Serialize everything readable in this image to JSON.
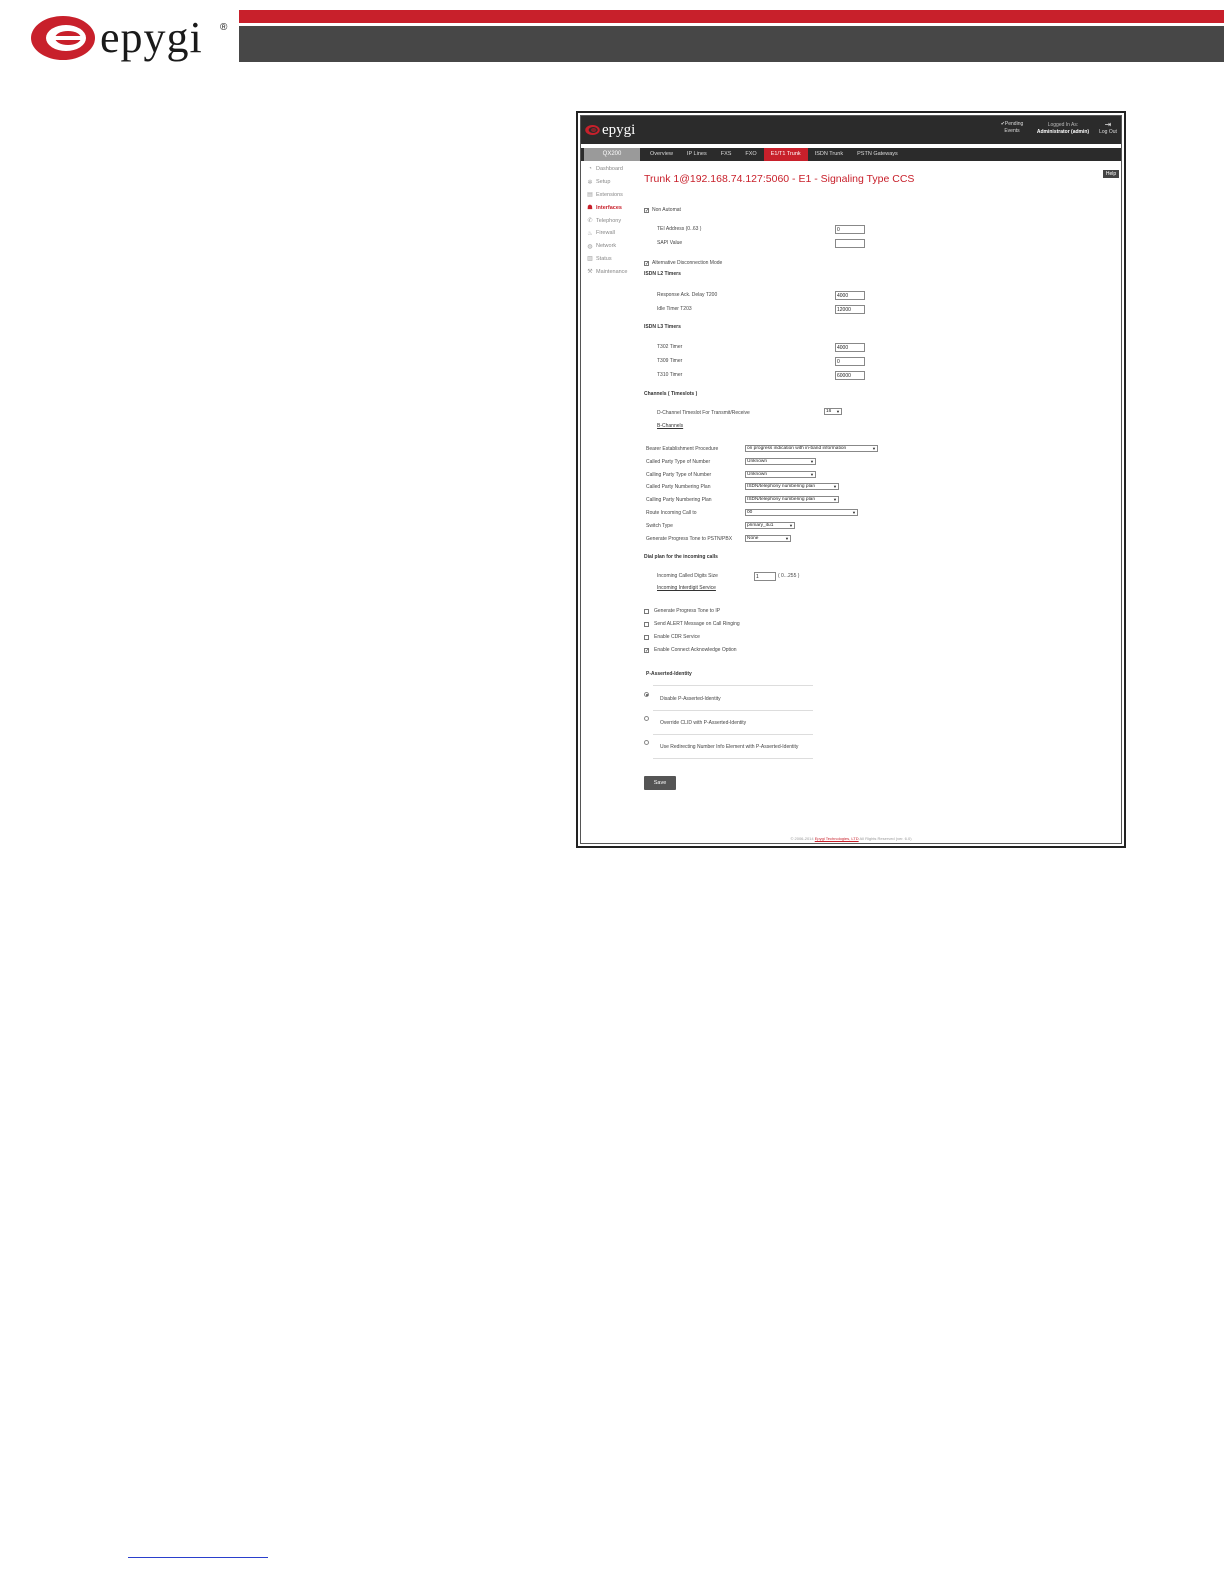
{
  "doc_header": {
    "brand": "epygi",
    "registered_mark": "®",
    "colors": {
      "red": "#c8202b",
      "dark": "#474747"
    }
  },
  "app": {
    "logo_text": "epygi",
    "top": {
      "pending_label": "✔Pending Events",
      "logged_prefix": "Logged In As:",
      "logged_user": "Administrator (admin)",
      "logout_label": "Log Out",
      "logout_icon": "logout-icon"
    },
    "model": "QX200",
    "tabs": [
      "Overview",
      "IP Lines",
      "FXS",
      "FXO",
      "E1/T1 Trunk",
      "ISDN Trunk",
      "PSTN Gateways"
    ],
    "active_tab": "E1/T1 Trunk",
    "sidebar": [
      {
        "label": "Dashboard",
        "icon": "dashboard-icon"
      },
      {
        "label": "Setup",
        "icon": "gear-icon"
      },
      {
        "label": "Extensions",
        "icon": "extensions-icon"
      },
      {
        "label": "Interfaces",
        "icon": "interfaces-icon",
        "active": true
      },
      {
        "label": "Telephony",
        "icon": "phone-icon"
      },
      {
        "label": "Firewall",
        "icon": "firewall-icon"
      },
      {
        "label": "Network",
        "icon": "globe-icon"
      },
      {
        "label": "Status",
        "icon": "chart-icon"
      },
      {
        "label": "Maintenance",
        "icon": "wrench-icon"
      }
    ],
    "help_label": "Help",
    "title": "Trunk 1@192.168.74.127:5060 - E1 - Signaling Type CCS",
    "form": {
      "non_automat": "Non Automat",
      "tei_address_label": "TEI Address (0..63 )",
      "tei_address_value": "0",
      "sapi_label": "SAPI Value",
      "sapi_value": "",
      "alt_disconnect": "Alternative Disconnection Mode",
      "l2_header": "ISDN L2 Timers",
      "t200_label": "Response Ack. Delay T200",
      "t200_value": "4000",
      "t203_label": "Idle Timer T203",
      "t203_value": "12000",
      "l3_header": "ISDN L3 Timers",
      "t302_label": "T302 Timer",
      "t302_value": "4000",
      "t309_label": "T309 Timer",
      "t309_value": "0",
      "t310_label": "T310 Timer",
      "t310_value": "60000",
      "channels_header": "Channels ( Timeslots )",
      "dchannel_label": "D-Channel Timeslot For Transmit/Receive",
      "dchannel_value": "16",
      "bchannels_link": "B-Channels",
      "bearer_label": "Bearer Establishment Procedure",
      "bearer_value": "on progress indication with in-band information",
      "called_ton_label": "Called Party Type of Number",
      "called_ton_value": "Unknown",
      "calling_ton_label": "Calling Party Type of Number",
      "calling_ton_value": "Unknown",
      "called_np_label": "Called Party Numbering Plan",
      "called_np_value": "ISDN/telephony numbering plan",
      "calling_np_label": "Calling Party Numbering Plan",
      "calling_np_value": "ISDN/telephony numbering plan",
      "route_label": "Route Incoming Call to",
      "route_value": "00",
      "switch_label": "Switch Type",
      "switch_value": "primary_itu1",
      "progress_tone_label": "Generate Progress Tone to PSTN/PBX",
      "progress_tone_value": "None",
      "dialplan_header": "Dial plan for the incoming calls",
      "digits_label": "Incoming Called Digits Size",
      "digits_value": "1",
      "digits_range": "( 0...255 )",
      "interdigit_link": "Incoming Interdigit Service",
      "gen_progress_ip": "Generate Progress Tone to IP",
      "send_alert": "Send ALERT Message on Call Ringing",
      "enable_cdr": "Enable CDR Service",
      "enable_connect_ack": "Enable Connect Acknowledge Option",
      "pai_header": "P-Asserted-Identity",
      "pai_options": [
        "Disable P-Asserted-Identity",
        "Override CLID with P-Asserted-Identity",
        "Use Redirecting Number Info Element with P-Asserted-Identity"
      ],
      "save_label": "Save"
    },
    "footer_prefix": "© 2006-2014",
    "footer_link": "Epygi Technologies, LTD",
    "footer_suffix": "All Rights Reserved (ver. 6.0)"
  }
}
